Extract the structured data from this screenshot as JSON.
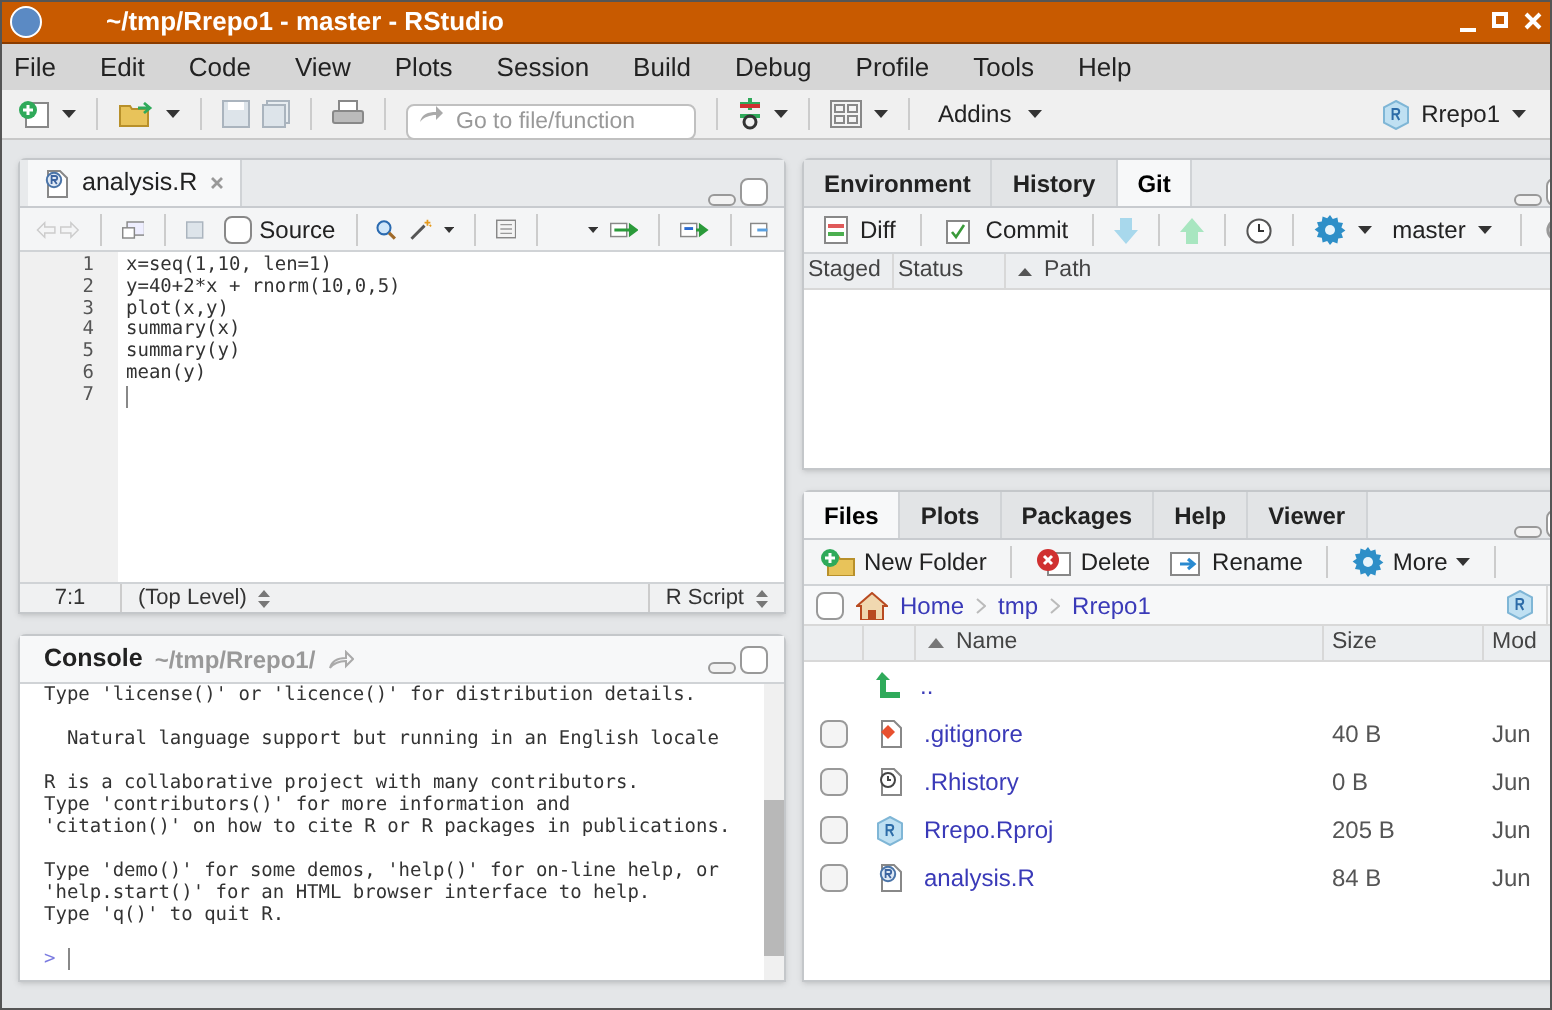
{
  "window": {
    "title": "~/tmp/Rrepo1 - master - RStudio"
  },
  "menu": [
    "File",
    "Edit",
    "Code",
    "View",
    "Plots",
    "Session",
    "Build",
    "Debug",
    "Profile",
    "Tools",
    "Help"
  ],
  "toolbar": {
    "search": {
      "placeholder": "Go to file/function"
    },
    "addins": "Addins",
    "project": "Rrepo1"
  },
  "editor": {
    "tab": "analysis.R",
    "source": {
      "label": "Source",
      "checked": false
    },
    "lines": [
      {
        "number": "1",
        "code": "x=seq(1,10, len=1)"
      },
      {
        "number": "2",
        "code": "y=40+2*x + rnorm(10,0,5)"
      },
      {
        "number": "3",
        "code": "plot(x,y)"
      },
      {
        "number": "4",
        "code": "summary(x)"
      },
      {
        "number": "5",
        "code": "summary(y)"
      },
      {
        "number": "6",
        "code": "mean(y)"
      },
      {
        "number": "7"
      }
    ],
    "status": {
      "position": "7:1",
      "scope": "(Top Level)",
      "filetype": "R Script"
    }
  },
  "console": {
    "title": "Console",
    "path": "~/tmp/Rrepo1/",
    "blocks": [
      [
        "Type 'license()' or 'licence()' for distribution details."
      ],
      [
        "  Natural language support but running in an English locale"
      ],
      [
        "R is a collaborative project with many contributors.",
        "Type 'contributors()' for more information and",
        "'citation()' on how to cite R or R packages in publications."
      ],
      [
        "Type 'demo()' for some demos, 'help()' for on-line help, or",
        "'help.start()' for an HTML browser interface to help.",
        "Type 'q()' to quit R."
      ]
    ],
    "prompt": ">"
  },
  "git_pane": {
    "tabs": [
      {
        "label": "Environment",
        "selected": false
      },
      {
        "label": "History",
        "selected": false
      },
      {
        "label": "Git",
        "selected": true
      }
    ],
    "buttons": [
      {
        "label": "Diff",
        "kind": "diff"
      },
      {
        "label": "Commit",
        "kind": "commit"
      }
    ],
    "branch": "master",
    "columns": [
      "Staged",
      "Status",
      "Path"
    ]
  },
  "files_pane": {
    "tabs": [
      {
        "label": "Files",
        "selected": true
      },
      {
        "label": "Plots",
        "selected": false
      },
      {
        "label": "Packages",
        "selected": false
      },
      {
        "label": "Help",
        "selected": false
      },
      {
        "label": "Viewer",
        "selected": false
      }
    ],
    "buttons": [
      {
        "label": "New Folder",
        "kind": "new-folder"
      },
      {
        "label": "Delete",
        "kind": "delete"
      },
      {
        "label": "Rename",
        "kind": "rename"
      },
      {
        "label": "More",
        "kind": "more"
      }
    ],
    "select_all": {
      "checked": false
    },
    "breadcrumb": [
      "Home",
      "tmp",
      "Rrepo1"
    ],
    "columns": [
      "Name",
      "Size",
      "Mod"
    ],
    "parent": "..",
    "rows": [
      {
        "name": ".gitignore",
        "size": "40 B",
        "modified": "Jun",
        "kind": "git",
        "checked": false
      },
      {
        "name": ".Rhistory",
        "size": "0 B",
        "modified": "Jun",
        "kind": "history",
        "checked": false
      },
      {
        "name": "Rrepo.Rproj",
        "size": "205 B",
        "modified": "Jun",
        "kind": "rproj",
        "checked": false
      },
      {
        "name": "analysis.R",
        "size": "84 B",
        "modified": "Jun",
        "kind": "r",
        "checked": false
      }
    ]
  }
}
